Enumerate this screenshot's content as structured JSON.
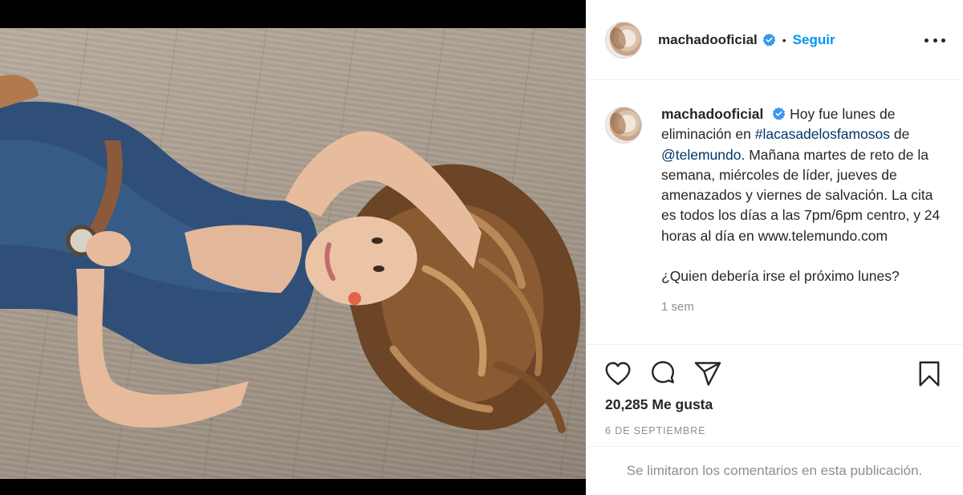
{
  "post": {
    "image_alt": "Foto de mujer recostada en el piso con overol de mezclilla y cabello ondulado",
    "colors": {
      "accent_blue": "#0095f6",
      "link_blue": "#00376b",
      "muted_gray": "#8e8e8e",
      "text": "#262626"
    }
  },
  "header": {
    "username": "machadooficial",
    "verified_icon": "verified-badge-icon",
    "separator": "•",
    "follow_label": "Seguir",
    "more_icon": "more-options-icon"
  },
  "caption": {
    "username": "machadooficial",
    "text_1": "Hoy fue lunes de eliminación en ",
    "hashtag": "#lacasadelosfamosos",
    "text_2": " de ",
    "mention": "@telemundo",
    "text_3": ". Mañana martes de reto de la semana, miércoles de líder, jueves de amenazados y viernes de salvación. La cita es todos los días a las 7pm/6pm centro, y 24 horas al día en www.telemundo.com",
    "question": "¿Quien debería irse el próximo lunes?",
    "time": "1 sem"
  },
  "actions": {
    "like_icon": "heart-icon",
    "comment_icon": "comment-bubble-icon",
    "share_icon": "paper-plane-icon",
    "save_icon": "bookmark-icon"
  },
  "likes": "20,285 Me gusta",
  "date": "6 DE SEPTIEMBRE",
  "comments_notice": "Se limitaron los comentarios en esta publicación."
}
